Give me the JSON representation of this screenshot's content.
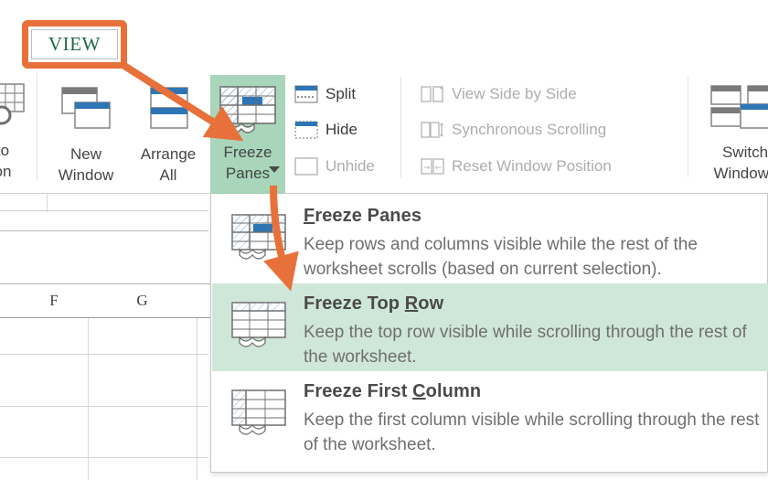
{
  "annotation": {
    "callout_label": "VIEW",
    "callout_border_color": "#e8703a",
    "callout_text_color": "#1d6b48",
    "arrow_color": "#e8703a",
    "arrows": [
      {
        "name": "view-tab-to-freeze-panes-arrow",
        "from": "VIEW callout",
        "to": "Freeze Panes ribbon button"
      },
      {
        "name": "freeze-panes-to-freeze-top-row-arrow",
        "from": "Freeze Panes dropdown arrow",
        "to": "Freeze Top Row menu item"
      }
    ]
  },
  "ribbon": {
    "accent_highlight": "#a9d6bb",
    "buttons": [
      {
        "id": "zoom-to-selection",
        "label": "to\non",
        "icon": "magnifier-icon",
        "state": "clipped"
      },
      {
        "id": "new-window",
        "label": "New\nWindow",
        "icon": "new-window-icon",
        "state": "normal"
      },
      {
        "id": "arrange-all",
        "label": "Arrange\nAll",
        "icon": "arrange-all-icon",
        "state": "normal"
      },
      {
        "id": "freeze-panes",
        "label": "Freeze\nPanes",
        "icon": "freeze-panes-icon",
        "state": "highlighted",
        "has_dropdown": true
      },
      {
        "id": "switch-windows",
        "label": "Switch\nWindows",
        "icon": "switch-windows-icon",
        "state": "clipped",
        "has_dropdown": true
      }
    ],
    "small_commands": [
      {
        "id": "split",
        "label": "Split",
        "icon": "split-window-icon",
        "enabled": true
      },
      {
        "id": "hide",
        "label": "Hide",
        "icon": "hide-window-icon",
        "enabled": true
      },
      {
        "id": "unhide",
        "label": "Unhide",
        "icon": "unhide-window-icon",
        "enabled": false
      },
      {
        "id": "view-side-by-side",
        "label": "View Side by Side",
        "icon": "side-by-side-icon",
        "enabled": false
      },
      {
        "id": "synchronous-scrolling",
        "label": "Synchronous Scrolling",
        "icon": "sync-scroll-icon",
        "enabled": false
      },
      {
        "id": "reset-window-position",
        "label": "Reset Window Position",
        "icon": "reset-window-icon",
        "enabled": false
      }
    ]
  },
  "menu": {
    "items": [
      {
        "id": "freeze-panes",
        "title_pre": "",
        "title_accel": "F",
        "title_post": "reeze Panes",
        "title_plain": "Freeze Panes",
        "desc": "Keep rows and columns visible while the rest of the worksheet scrolls (based on current selection).",
        "icon": "freeze-panes-menu-icon",
        "selected": false
      },
      {
        "id": "freeze-top-row",
        "title_pre": "Freeze Top ",
        "title_accel": "R",
        "title_post": "ow",
        "title_plain": "Freeze Top Row",
        "desc": "Keep the top row visible while scrolling through the rest of the worksheet.",
        "icon": "freeze-top-row-menu-icon",
        "selected": true
      },
      {
        "id": "freeze-first-column",
        "title_pre": "Freeze First ",
        "title_accel": "C",
        "title_post": "olumn",
        "title_plain": "Freeze First Column",
        "desc": "Keep the first column visible while scrolling through the rest of the worksheet.",
        "icon": "freeze-first-column-menu-icon",
        "selected": false
      }
    ],
    "selected_bg": "#cfe7d8"
  },
  "worksheet": {
    "column_headers": [
      "F",
      "G"
    ]
  }
}
